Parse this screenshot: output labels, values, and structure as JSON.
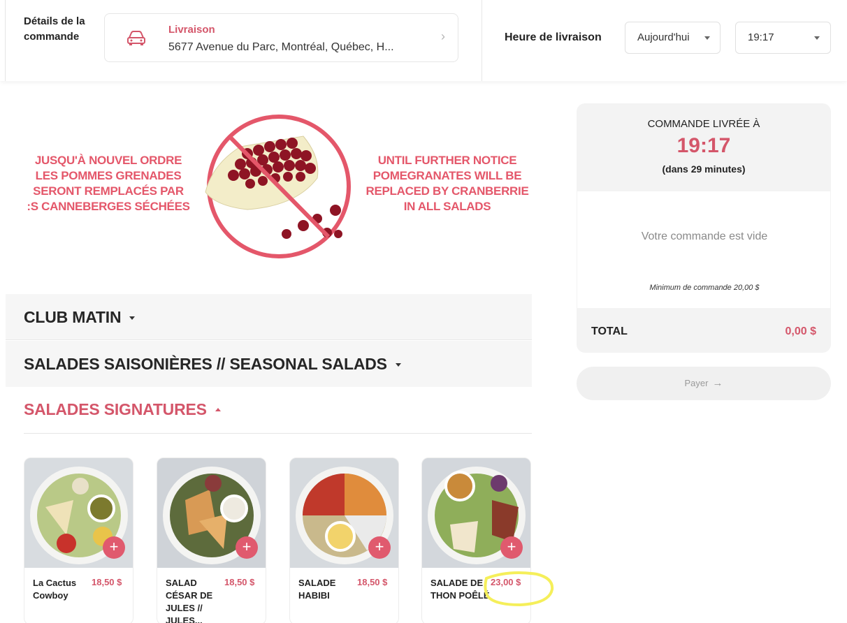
{
  "header": {
    "order_details_label": "Détails de la commande",
    "delivery_mode": "Livraison",
    "delivery_address": "5677 Avenue du Parc, Montréal, Québec, H...",
    "delivery_time_label": "Heure de livraison",
    "day_select_value": "Aujourd'hui",
    "time_select_value": "19:17"
  },
  "banner": {
    "fr_lines": [
      "JUSQU'À NOUVEL ORDRE",
      "LES POMMES GRENADES",
      "SERONT REMPLACÉS PAR",
      ":S CANNEBERGES SÉCHÉES"
    ],
    "en_lines": [
      "UNTIL FURTHER NOTICE",
      "POMEGRANATES WILL BE",
      "REPLACED BY CRANBERRIE",
      "IN ALL SALADS"
    ]
  },
  "categories": [
    {
      "label": "CLUB MATIN",
      "expanded": false
    },
    {
      "label": "SALADES SAISONIÈRES // SEASONAL SALADS",
      "expanded": false
    },
    {
      "label": "SALADES SIGNATURES",
      "expanded": true
    }
  ],
  "products": [
    {
      "name": "La Cactus Cowboy",
      "price": "18,50 $"
    },
    {
      "name": "SALAD CÉSAR DE JULES // JULES...",
      "price": "18,50 $"
    },
    {
      "name": "SALADE HABIBI",
      "price": "18,50 $"
    },
    {
      "name": "SALADE DE THON POÊLÉ",
      "price": "23,00 $"
    }
  ],
  "add_symbol": "+",
  "summary": {
    "delivered_at_label": "COMMANDE LIVRÉE À",
    "delivery_time": "19:17",
    "eta": "(dans 29 minutes)",
    "empty_message": "Votre commande est vide",
    "minimum": "Minimum de commande 20,00 $",
    "total_label": "TOTAL",
    "total_value": "0,00 $"
  },
  "pay_button": {
    "label": "Payer",
    "arrow": "→"
  },
  "icons": {
    "delivery": "car-icon",
    "chevron": "chevron-right-icon",
    "dropdown": "caret-down-icon"
  },
  "colors": {
    "accent": "#d4566a",
    "banner_red": "#e4576a",
    "panel_bg": "#f3f3f3",
    "highlight": "#f5ef5a"
  }
}
